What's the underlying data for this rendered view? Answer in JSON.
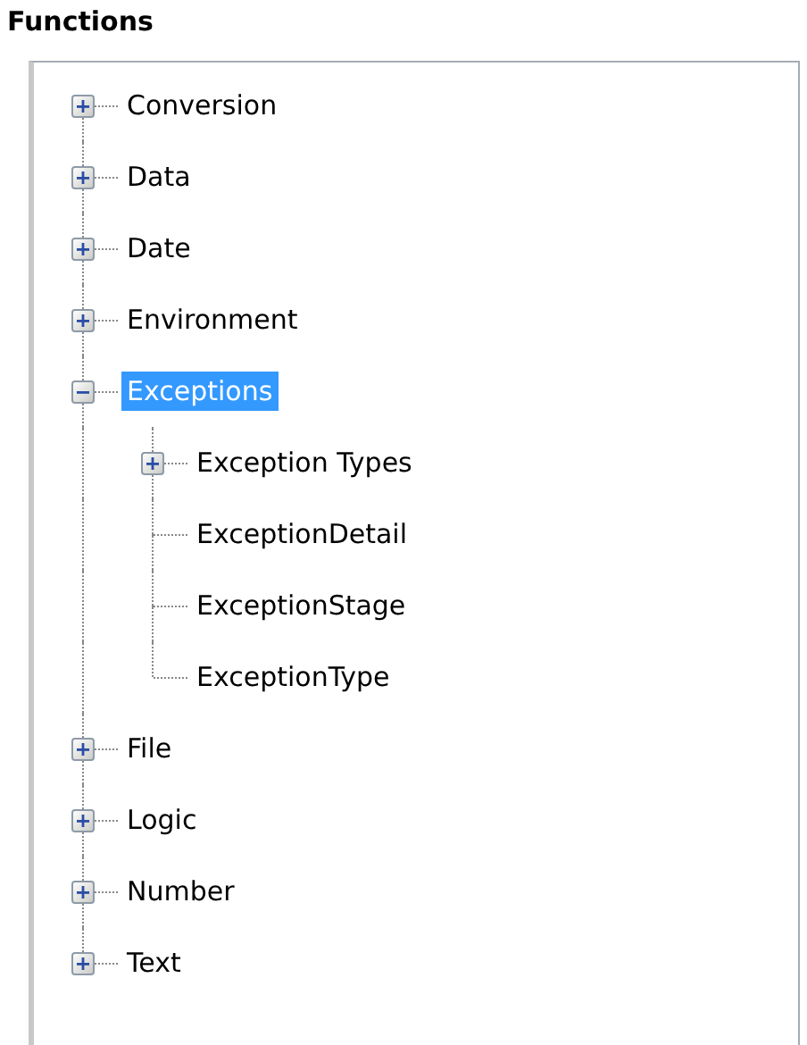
{
  "title": "Functions",
  "items": [
    {
      "label": "Conversion",
      "kind": "group",
      "expanded": false,
      "selected": false
    },
    {
      "label": "Data",
      "kind": "group",
      "expanded": false,
      "selected": false
    },
    {
      "label": "Date",
      "kind": "group",
      "expanded": false,
      "selected": false
    },
    {
      "label": "Environment",
      "kind": "group",
      "expanded": false,
      "selected": false
    },
    {
      "label": "Exceptions",
      "kind": "group",
      "expanded": true,
      "selected": true,
      "children": [
        {
          "label": "Exception Types",
          "kind": "group",
          "expanded": false,
          "selected": false
        },
        {
          "label": "ExceptionDetail",
          "kind": "leaf",
          "selected": false
        },
        {
          "label": "ExceptionStage",
          "kind": "leaf",
          "selected": false
        },
        {
          "label": "ExceptionType",
          "kind": "leaf",
          "selected": false
        }
      ]
    },
    {
      "label": "File",
      "kind": "group",
      "expanded": false,
      "selected": false
    },
    {
      "label": "Logic",
      "kind": "group",
      "expanded": false,
      "selected": false
    },
    {
      "label": "Number",
      "kind": "group",
      "expanded": false,
      "selected": false
    },
    {
      "label": "Text",
      "kind": "group",
      "expanded": false,
      "selected": false
    }
  ]
}
